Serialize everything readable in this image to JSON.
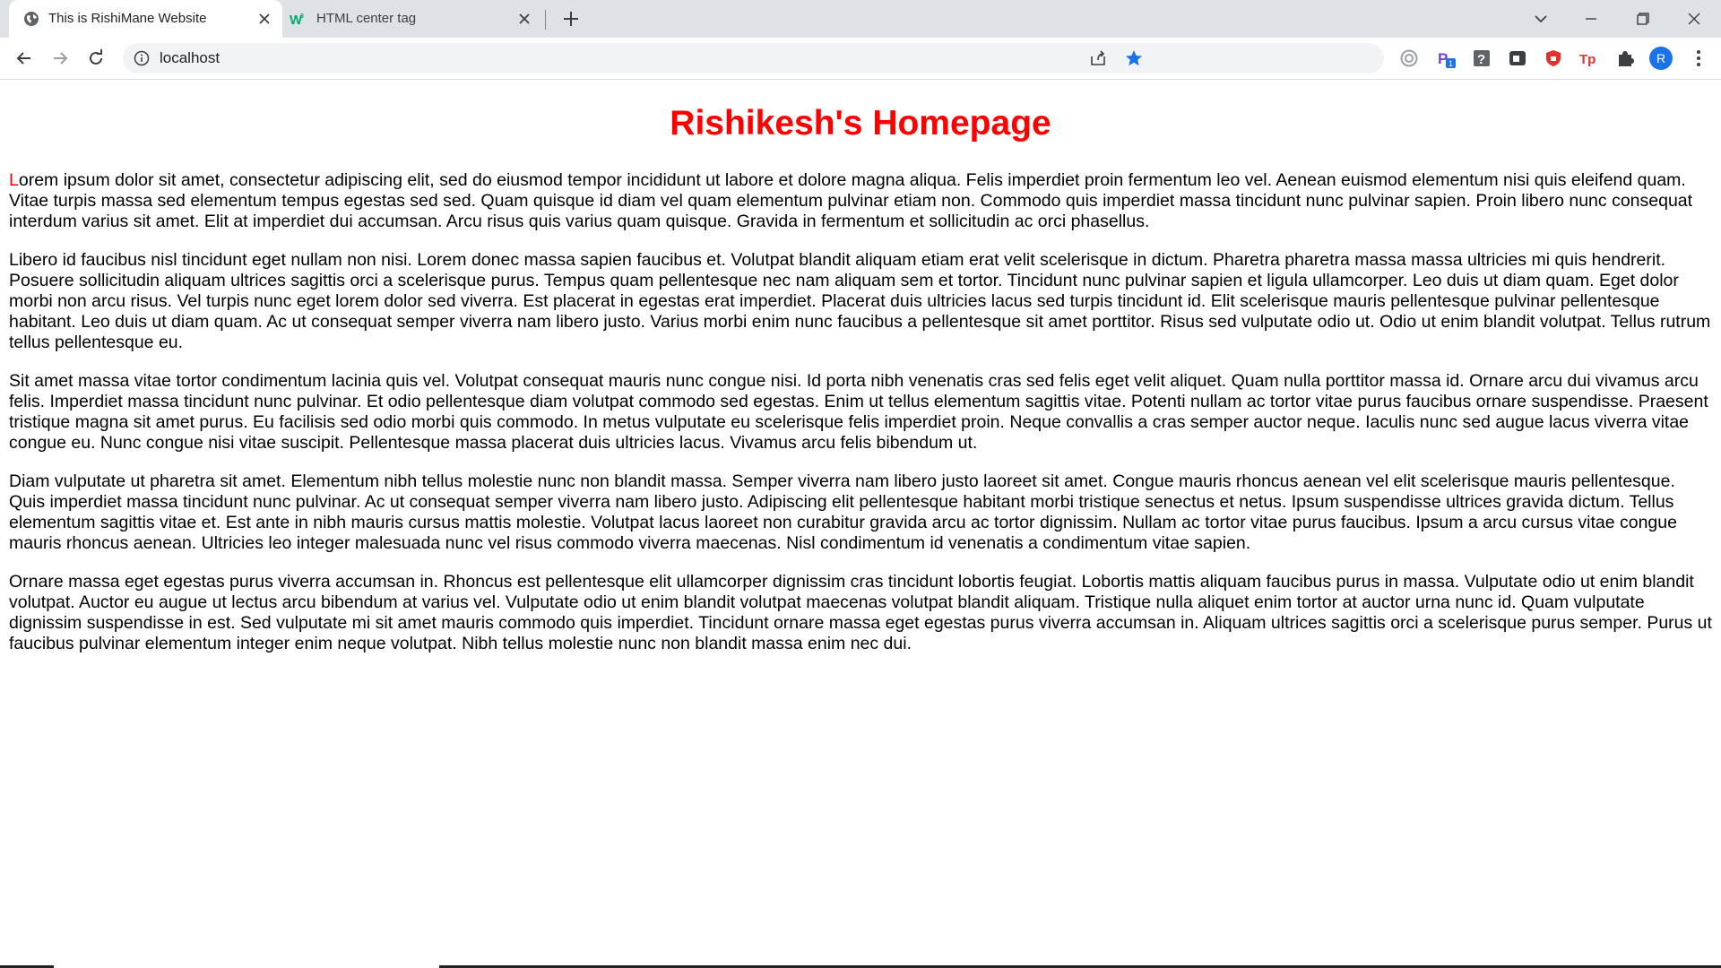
{
  "browser": {
    "tabs": [
      {
        "title": "This is RishiMane Website",
        "active": true,
        "favicon": "globe-icon"
      },
      {
        "title": "HTML center tag",
        "active": false,
        "favicon": "w3-favicon-icon"
      }
    ],
    "address": "localhost",
    "avatar_letter": "R",
    "extension_badge": "1"
  },
  "page": {
    "heading": "Rishikesh's Homepage",
    "first_letter": "L",
    "first_paragraph_rest": "orem ipsum dolor sit amet, consectetur adipiscing elit, sed do eiusmod tempor incididunt ut labore et dolore magna aliqua. Felis imperdiet proin fermentum leo vel. Aenean euismod elementum nisi quis eleifend quam. Vitae turpis massa sed elementum tempus egestas sed sed. Quam quisque id diam vel quam elementum pulvinar etiam non. Commodo quis imperdiet massa tincidunt nunc pulvinar sapien. Proin libero nunc consequat interdum varius sit amet. Elit at imperdiet dui accumsan. Arcu risus quis varius quam quisque. Gravida in fermentum et sollicitudin ac orci phasellus.",
    "paragraphs": [
      "Libero id faucibus nisl tincidunt eget nullam non nisi. Lorem donec massa sapien faucibus et. Volutpat blandit aliquam etiam erat velit scelerisque in dictum. Pharetra pharetra massa massa ultricies mi quis hendrerit. Posuere sollicitudin aliquam ultrices sagittis orci a scelerisque purus. Tempus quam pellentesque nec nam aliquam sem et tortor. Tincidunt nunc pulvinar sapien et ligula ullamcorper. Leo duis ut diam quam. Eget dolor morbi non arcu risus. Vel turpis nunc eget lorem dolor sed viverra. Est placerat in egestas erat imperdiet. Placerat duis ultricies lacus sed turpis tincidunt id. Elit scelerisque mauris pellentesque pulvinar pellentesque habitant. Leo duis ut diam quam. Ac ut consequat semper viverra nam libero justo. Varius morbi enim nunc faucibus a pellentesque sit amet porttitor. Risus sed vulputate odio ut. Odio ut enim blandit volutpat. Tellus rutrum tellus pellentesque eu.",
      "Sit amet massa vitae tortor condimentum lacinia quis vel. Volutpat consequat mauris nunc congue nisi. Id porta nibh venenatis cras sed felis eget velit aliquet. Quam nulla porttitor massa id. Ornare arcu dui vivamus arcu felis. Imperdiet massa tincidunt nunc pulvinar. Et odio pellentesque diam volutpat commodo sed egestas. Enim ut tellus elementum sagittis vitae. Potenti nullam ac tortor vitae purus faucibus ornare suspendisse. Praesent tristique magna sit amet purus. Eu facilisis sed odio morbi quis commodo. In metus vulputate eu scelerisque felis imperdiet proin. Neque convallis a cras semper auctor neque. Iaculis nunc sed augue lacus viverra vitae congue eu. Nunc congue nisi vitae suscipit. Pellentesque massa placerat duis ultricies lacus. Vivamus arcu felis bibendum ut.",
      "Diam vulputate ut pharetra sit amet. Elementum nibh tellus molestie nunc non blandit massa. Semper viverra nam libero justo laoreet sit amet. Congue mauris rhoncus aenean vel elit scelerisque mauris pellentesque. Quis imperdiet massa tincidunt nunc pulvinar. Ac ut consequat semper viverra nam libero justo. Adipiscing elit pellentesque habitant morbi tristique senectus et netus. Ipsum suspendisse ultrices gravida dictum. Tellus elementum sagittis vitae et. Est ante in nibh mauris cursus mattis molestie. Volutpat lacus laoreet non curabitur gravida arcu ac tortor dignissim. Nullam ac tortor vitae purus faucibus. Ipsum a arcu cursus vitae congue mauris rhoncus aenean. Ultricies leo integer malesuada nunc vel risus commodo viverra maecenas. Nisl condimentum id venenatis a condimentum vitae sapien.",
      "Ornare massa eget egestas purus viverra accumsan in. Rhoncus est pellentesque elit ullamcorper dignissim cras tincidunt lobortis feugiat. Lobortis mattis aliquam faucibus purus in massa. Vulputate odio ut enim blandit volutpat. Auctor eu augue ut lectus arcu bibendum at varius vel. Vulputate odio ut enim blandit volutpat maecenas volutpat blandit aliquam. Tristique nulla aliquet enim tortor at auctor urna nunc id. Quam vulputate dignissim suspendisse in est. Sed vulputate mi sit amet mauris commodo quis imperdiet. Tincidunt ornare massa eget egestas purus viverra accumsan in. Aliquam ultrices sagittis orci a scelerisque purus semper. Purus ut faucibus pulvinar elementum integer enim neque volutpat. Nibh tellus molestie nunc non blandit massa enim nec dui."
    ]
  },
  "colors": {
    "heading": "#ff0000",
    "dropcap": "#ff0000",
    "tabstrip": "#dee1e6",
    "omnibox": "#f1f3f4"
  }
}
